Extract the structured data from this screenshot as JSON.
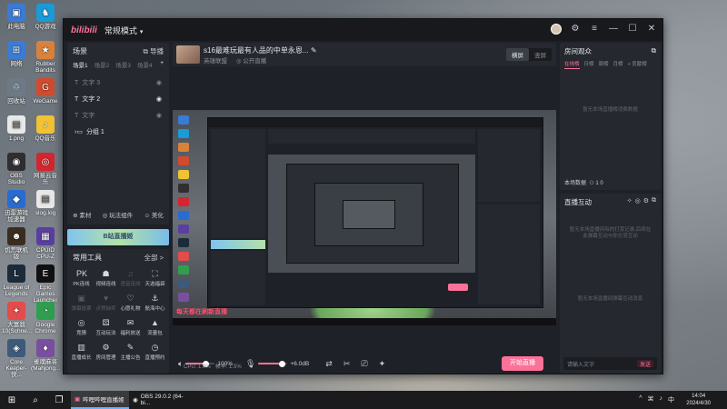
{
  "desktop": {
    "icons": [
      {
        "label": "此电脑",
        "color": "#3a7bd5",
        "glyph": "▣"
      },
      {
        "label": "QQ游戏",
        "color": "#1a9ad6",
        "glyph": "♞"
      },
      {
        "label": "网络",
        "color": "#3a7bd5",
        "glyph": "⊞"
      },
      {
        "label": "Rubber Bandits",
        "color": "#d9823b",
        "glyph": "★"
      },
      {
        "label": "回收站",
        "color": "#6d7a86",
        "glyph": "♲"
      },
      {
        "label": "WeGame",
        "color": "#d14b2f",
        "glyph": "G"
      },
      {
        "label": "1.png",
        "color": "#e8e8e8",
        "glyph": "▤"
      },
      {
        "label": "QQ音乐",
        "color": "#f1c232",
        "glyph": "♪"
      },
      {
        "label": "OBS Studio",
        "color": "#302e31",
        "glyph": "◉"
      },
      {
        "label": "网易云音乐",
        "color": "#d4262e",
        "glyph": "◎"
      },
      {
        "label": "迅雷游戏加速器",
        "color": "#2a6bd1",
        "glyph": "◆"
      },
      {
        "label": "slog.log",
        "color": "#e8e8e8",
        "glyph": "▤"
      },
      {
        "label": "饥荒联机版",
        "color": "#3a2d20",
        "glyph": "☻"
      },
      {
        "label": "CPUID CPU-Z",
        "color": "#5a3fa0",
        "glyph": "▦"
      },
      {
        "label": "League of Legends",
        "color": "#1c2b3a",
        "glyph": "L"
      },
      {
        "label": "Epic Games Launcher",
        "color": "#111111",
        "glyph": "E"
      },
      {
        "label": "大富翁10(Schne...",
        "color": "#e44b4b",
        "glyph": "✦"
      },
      {
        "label": "Google Chrome",
        "color": "#2f9e4f",
        "glyph": "◔"
      },
      {
        "label": "Core Keeper- 快...",
        "color": "#3e5a7a",
        "glyph": "◈"
      },
      {
        "label": "雀魂麻将(Mahjong...",
        "color": "#7a4fa0",
        "glyph": "♦"
      }
    ]
  },
  "window": {
    "logo": "bilibili",
    "mode": "常规模式",
    "mode_caret": "▾",
    "controls": {
      "settings": "⚙",
      "help": "?",
      "menu": "≡",
      "minimize": "—",
      "maximize": "☐",
      "close": "✕"
    }
  },
  "scenes": {
    "title": "场景",
    "guide": "导播",
    "tabs": [
      "场景1",
      "场景2",
      "场景3",
      "场景4"
    ],
    "add": "+",
    "sources": [
      {
        "label": "文字 3",
        "active": false
      },
      {
        "label": "文字 2",
        "active": true
      },
      {
        "label": "文字",
        "active": false
      },
      {
        "label": "分组 1",
        "active": true,
        "group": true
      }
    ],
    "actions": [
      "素材",
      "玩法组件",
      "美化"
    ]
  },
  "banner": {
    "text": "B站直播姬"
  },
  "tools": {
    "title": "常用工具",
    "more": "全部 >",
    "items": [
      {
        "label": "PK连线",
        "icon": "PK",
        "dim": false
      },
      {
        "label": "视频连线",
        "icon": "☗",
        "dim": false
      },
      {
        "label": "语音连线",
        "icon": "♫",
        "dim": true
      },
      {
        "label": "天选福袋",
        "icon": "⛶",
        "dim": false
      },
      {
        "label": "弹幕投票",
        "icon": "▣",
        "dim": true
      },
      {
        "label": "点赞抽奖",
        "icon": "♥",
        "dim": true
      },
      {
        "label": "心愿礼物",
        "icon": "♡",
        "dim": false
      },
      {
        "label": "航海中心",
        "icon": "⚓",
        "dim": false
      },
      {
        "label": "竞猜",
        "icon": "◎",
        "dim": false
      },
      {
        "label": "互动玩法",
        "icon": "⚄",
        "dim": false
      },
      {
        "label": "福利放送",
        "icon": "✉",
        "dim": false
      },
      {
        "label": "流量包",
        "icon": "▲",
        "dim": false
      },
      {
        "label": "直播成长",
        "icon": "▥",
        "dim": false
      },
      {
        "label": "房间管理",
        "icon": "⚙",
        "dim": false
      },
      {
        "label": "主播公告",
        "icon": "✎",
        "dim": false
      },
      {
        "label": "直播预约",
        "icon": "◷",
        "dim": false
      }
    ]
  },
  "stream": {
    "title": "s16最难玩最有人品的中单永恩...",
    "edit_icon": "✎",
    "category": "英雄联盟",
    "public": "公开直播",
    "orientation": [
      "横屏",
      "竖屏"
    ],
    "orientation_active": 0
  },
  "preview": {
    "caption": "每天都在刷新直播"
  },
  "controls": {
    "speaker_volume": "100%",
    "speaker_level": 0.7,
    "mic_gain": "+6.0dB",
    "mic_level": 0.8,
    "start_label": "开始直播"
  },
  "stats": {
    "cpu": "CPU: 1.0%",
    "fps": "帧率: 1.5%"
  },
  "audience": {
    "title": "房间观众",
    "tabs": [
      "在线榜",
      "日榜",
      "周榜",
      "月榜",
      "+ 贡献榜"
    ],
    "empty_text": "暂无本场直播榜消费数据",
    "stat_label": "本场数据",
    "stat_values": "1  0"
  },
  "interaction": {
    "title": "直播互动",
    "hint": "暂无本场直播间有的打赏记录,后续在此弹幕互动与你交流互动",
    "empty": "暂无本场直播间弹幕互动消息",
    "input_placeholder": "请输入文字",
    "send_label": "发送"
  },
  "taskbar": {
    "start": "⊞",
    "search": "⌕",
    "apps": [
      {
        "label": "哔哩哔哩直播姬",
        "active": true
      },
      {
        "label": "OBS 29.0.2 (64-bi...",
        "active": false
      }
    ],
    "tray": [
      "^",
      "⌘",
      "♪",
      "中"
    ],
    "time": "14:04",
    "date": "2024/4/30"
  }
}
